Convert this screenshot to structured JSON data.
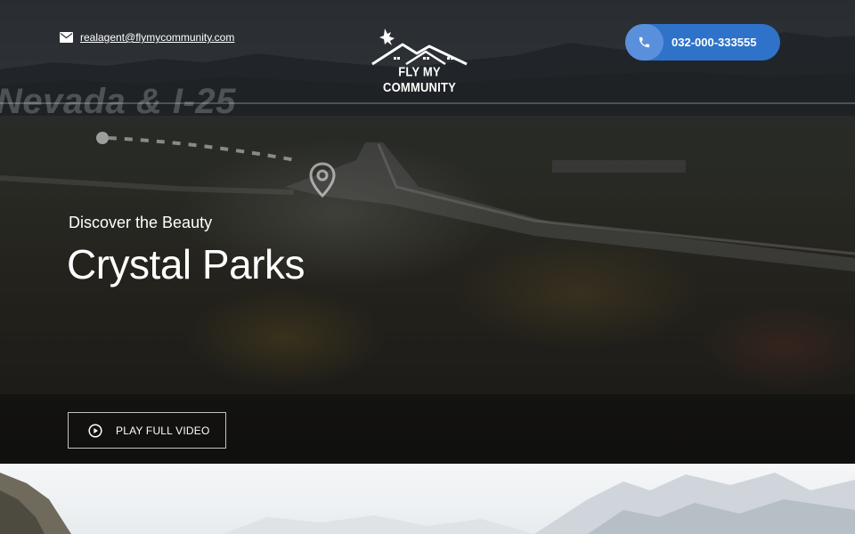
{
  "header": {
    "email": "realagent@flymycommunity.com",
    "email_icon": "envelope-icon",
    "logo_text": "FLY MY COMMUNITY",
    "phone": "032-000-333555",
    "phone_icon": "phone-icon"
  },
  "hero": {
    "watermark": "Nevada & I-25",
    "subtitle": "Discover the Beauty",
    "title": "Crystal Parks",
    "video_button_label": "PLAY FULL VIDEO",
    "video_button_icon": "play-circle-icon",
    "map_icon": "map-pin-icon"
  },
  "colors": {
    "accent": "#2f72c9",
    "accent_light": "#5a90db"
  }
}
